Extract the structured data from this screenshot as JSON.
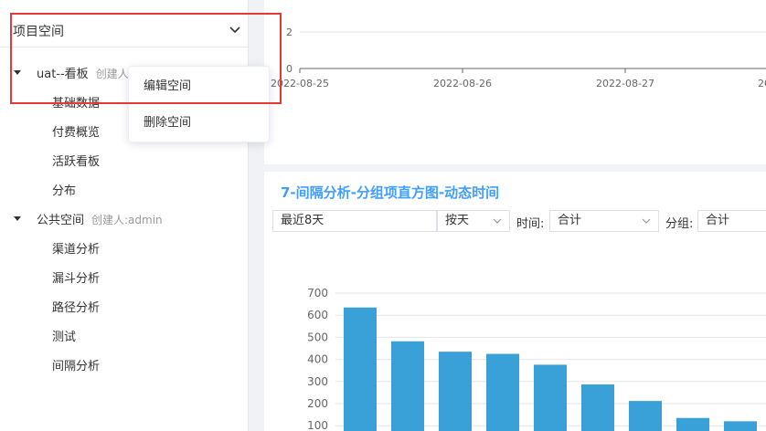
{
  "sidebar": {
    "space_title": "项目空间",
    "tree": [
      {
        "label": "uat--看板",
        "creator": "创建人",
        "children": [
          "基础数据",
          "付费概览",
          "活跃看板",
          "分布"
        ]
      },
      {
        "label": "公共空间",
        "creator": "创建人:admin",
        "children": [
          "渠道分析",
          "漏斗分析",
          "路径分析",
          "测试",
          "间隔分析"
        ]
      }
    ]
  },
  "context_menu": {
    "edit": "编辑空间",
    "delete": "删除空间"
  },
  "top_chart": {
    "y_ticks": [
      "2",
      "0"
    ],
    "x_ticks": [
      "2022-08-25",
      "2022-08-26",
      "2022-08-27",
      "20"
    ]
  },
  "panel": {
    "title": "7-间隔分析-分组项直方图-动态时间",
    "filters": {
      "range": "最近8天",
      "granularity": "按天",
      "time_label": "时间:",
      "time_value": "合计",
      "group_label": "分组:",
      "group_value": "合计"
    }
  },
  "chart_data": {
    "type": "bar",
    "categories": [
      "",
      "",
      "",
      "",
      "",
      "",
      "",
      "",
      ""
    ],
    "values": [
      635,
      482,
      435,
      425,
      376,
      287,
      212,
      135,
      120
    ],
    "y_ticks": [
      700,
      600,
      500,
      400,
      300,
      200,
      100
    ],
    "ylim": [
      0,
      700
    ],
    "grid": true,
    "color": "#3aa1d8"
  },
  "colors": {
    "accent": "#409eff",
    "highlight": "#e53935",
    "bar": "#3aa1d8"
  }
}
